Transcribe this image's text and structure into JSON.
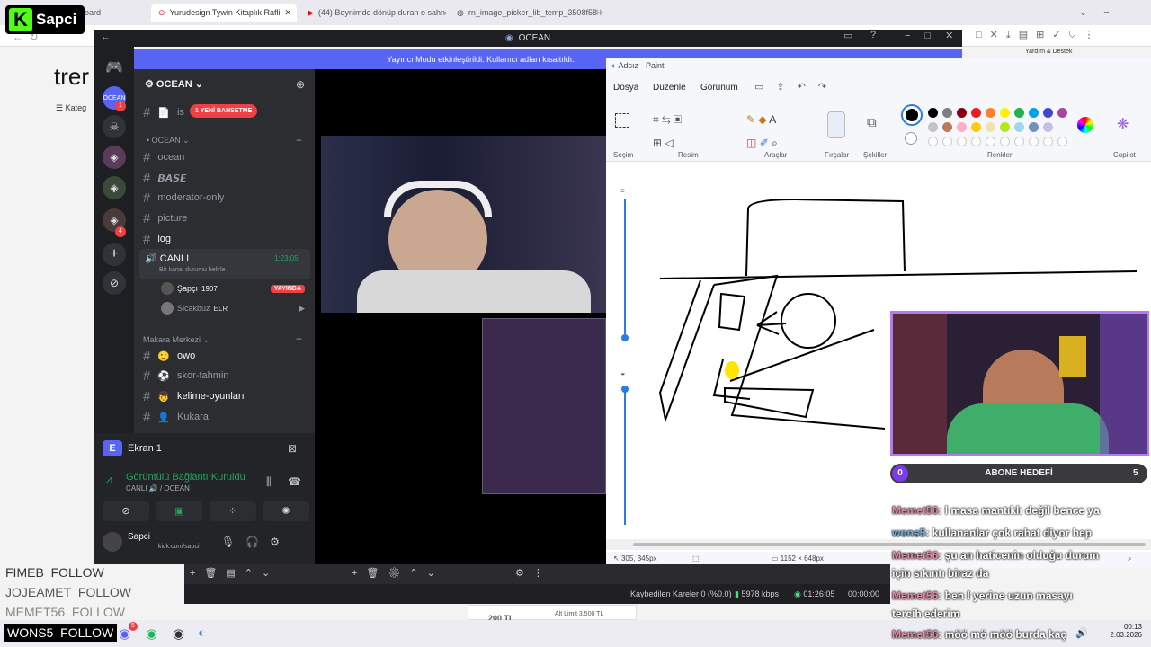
{
  "browser": {
    "tabs": [
      {
        "label": "Dashboard"
      },
      {
        "label": "Yurudesign Tywin Kitaplık Rafli"
      },
      {
        "label": "(44) Beynimde dönüp duran o sahne"
      },
      {
        "label": "rn_image_picker_lib_temp_3508f58b"
      }
    ],
    "behind_text_1": "trer",
    "behind_text_2": "Kateg"
  },
  "kick_logo": {
    "letter": "K",
    "name": "Sapci"
  },
  "discord": {
    "window_title": "OCEAN",
    "banner": "Yayıncı Modu etkinleştirildi. Kullanıcı adları kısaltıldı.",
    "server_name": "OCEAN",
    "unread_badge": "1 YENİ BAHSETME",
    "server_badges": [
      "1",
      "4"
    ],
    "channels": [
      {
        "name": "is",
        "type": "text"
      },
      {
        "name": "OCEAN",
        "type": "category"
      },
      {
        "name": "ocean",
        "type": "text"
      },
      {
        "name": "𝘽𝘼𝙎𝙀",
        "type": "text"
      },
      {
        "name": "moderator-only",
        "type": "text"
      },
      {
        "name": "picture",
        "type": "text"
      },
      {
        "name": "log",
        "type": "text",
        "bold": true
      },
      {
        "name": "CANLI",
        "type": "voice",
        "timer": "1:23:05",
        "status": "Bir kanal durumu belirle"
      },
      {
        "name": "Makara Merkezi",
        "type": "category"
      },
      {
        "name": "owo",
        "type": "text",
        "bold": true
      },
      {
        "name": "skor-tahmin",
        "type": "text"
      },
      {
        "name": "kelime-oyunları",
        "type": "text",
        "bold": true
      },
      {
        "name": "Kukara",
        "type": "text"
      }
    ],
    "voice_users": [
      {
        "name": "Şapçı",
        "tag": "1907",
        "badge": "YAYINDA"
      },
      {
        "name": "Sicakbuz",
        "tag": "ELR"
      }
    ],
    "screen_share": {
      "label": "Ekran 1",
      "initial": "E"
    },
    "connection": {
      "status": "Görüntülü Bağlantı Kuruldu",
      "location": "CANLI 🔊 / OCEAN"
    },
    "user": {
      "name": "Sapci",
      "subtitle": "kick.com/sapci"
    }
  },
  "paint": {
    "title": "Adsız - Paint",
    "menu": [
      "Dosya",
      "Düzenle",
      "Görünüm"
    ],
    "groups": [
      "Seçim",
      "Resim",
      "Araçlar",
      "Fırçalar",
      "Şekiller",
      "Renkler",
      "Copilot"
    ],
    "colors": [
      "#000000",
      "#7f7f7f",
      "#880015",
      "#ed1c24",
      "#ff7f27",
      "#fff200",
      "#22b14c",
      "#00a2e8",
      "#3f48cc",
      "#a349a4"
    ],
    "colors_row2": [
      "#c3c3c3",
      "#b97a57",
      "#ffaec9",
      "#ffc90e",
      "#efe4b0",
      "#b5e61d",
      "#99d9ea",
      "#7092be",
      "#c8bfe7"
    ],
    "cursor_pos": "305, 345px",
    "canvas_size": "1152 × 648px",
    "help": "Yardım & Destek"
  },
  "stream_overlay": {
    "abone_count": "0",
    "abone_label": "ABONE HEDEFİ",
    "abone_target": "5",
    "chat": [
      {
        "user": "Memet56",
        "text": ": l masa mantıklı değil bence ya"
      },
      {
        "user": "wons5",
        "text": ": kullananlar çok rahat diyor hep"
      },
      {
        "user": "Memet56",
        "text": ": şu an haticenin olduğu durum"
      },
      {
        "user": "",
        "text": "için sıkıntı biraz da"
      },
      {
        "user": "Memet56",
        "text": ": ben l yerine uzun masayı"
      },
      {
        "user": "",
        "text": "tercih ederim"
      },
      {
        "user": "Memet56",
        "text": ": möö mö möö burda kaç"
      }
    ],
    "follows": [
      {
        "name": "FIMEB",
        "action": "FOLLOW"
      },
      {
        "name": "JOJEAMET",
        "action": "FOLLOW"
      },
      {
        "name": "MEMET56",
        "action": "FOLLOW"
      },
      {
        "name": "WONS5",
        "action": "FOLLOW"
      }
    ]
  },
  "obs": {
    "dropped": "Kaybedilen Kareler 0 (%0.0)",
    "bitrate": "5978 kbps",
    "live_time": "01:26:05",
    "rec_time": "00:00:00",
    "limit": "Alt Limit 3.500 TL",
    "price": "200 TL"
  },
  "taskbar": {
    "time": "00:13",
    "date": "2.03.2026",
    "badge": "5"
  }
}
